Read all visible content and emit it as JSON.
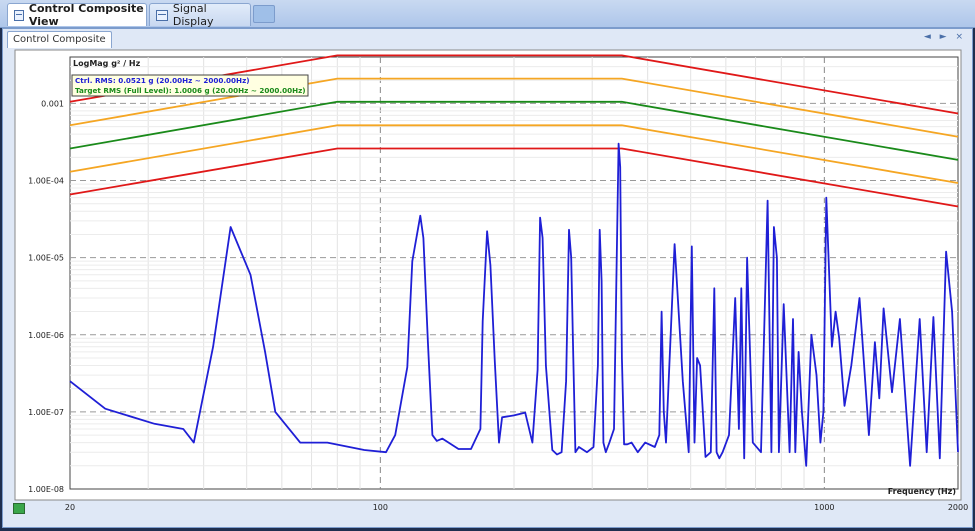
{
  "tabs": [
    {
      "label": "Control Composite View",
      "active": true
    },
    {
      "label": "Signal Display",
      "active": false
    }
  ],
  "panel": {
    "tab_label": "Control Composite",
    "controls": "◄ ► ×"
  },
  "colors": {
    "blue": "#1f1fd6",
    "red": "#e01818",
    "orange": "#f5a623",
    "green": "#1a8a1a",
    "grid": "#b0b0b0"
  },
  "chart_data": {
    "type": "line",
    "ylabel": "LogMag g² / Hz",
    "xlabel": "Frequency (Hz)",
    "x_scale": "log",
    "y_scale": "log",
    "xlim": [
      20,
      2000
    ],
    "ylim": [
      1e-08,
      0.004
    ],
    "x_tick_labels": [
      {
        "value": 20,
        "label": "20"
      },
      {
        "value": 100,
        "label": "100"
      },
      {
        "value": 1000,
        "label": "1000"
      },
      {
        "value": 2000,
        "label": "2000"
      }
    ],
    "y_tick_labels": [
      {
        "value": 0.001,
        "label": "0.001"
      },
      {
        "value": 0.0001,
        "label": "1.00E-04"
      },
      {
        "value": 1e-05,
        "label": "1.00E-05"
      },
      {
        "value": 1e-06,
        "label": "1.00E-06"
      },
      {
        "value": 1e-07,
        "label": "1.00E-07"
      },
      {
        "value": 1e-08,
        "label": "1.00E-08"
      }
    ],
    "grid": true,
    "legend": {
      "placement": "top-left",
      "entries": [
        {
          "text": "Ctrl. RMS: 0.0521 g (20.00Hz ~ 2000.00Hz)",
          "color": "#1f1fd6"
        },
        {
          "text": "Target RMS (Full Level): 1.0006 g (20.00Hz ~ 2000.00Hz)",
          "color": "#1a8a1a"
        }
      ]
    },
    "profile_lines": [
      {
        "color": "#e01818",
        "x": [
          20,
          80,
          350,
          2000
        ],
        "y": [
          0.00105,
          0.0042,
          0.0042,
          0.00074
        ]
      },
      {
        "color": "#f5a623",
        "x": [
          20,
          80,
          350,
          2000
        ],
        "y": [
          0.00052,
          0.0021,
          0.0021,
          0.00037
        ]
      },
      {
        "color": "#1a8a1a",
        "x": [
          20,
          80,
          350,
          2000
        ],
        "y": [
          0.00026,
          0.00105,
          0.00105,
          0.000185
        ]
      },
      {
        "color": "#f5a623",
        "x": [
          20,
          80,
          350,
          2000
        ],
        "y": [
          0.00013,
          0.00052,
          0.00052,
          9.3e-05
        ]
      },
      {
        "color": "#e01818",
        "x": [
          20,
          80,
          350,
          2000
        ],
        "y": [
          6.6e-05,
          0.00026,
          0.00026,
          4.6e-05
        ]
      }
    ],
    "series": [
      {
        "color": "#1f1fd6",
        "x": [
          20,
          24,
          31,
          36,
          38,
          42,
          46,
          51,
          55,
          58,
          66,
          76,
          92,
          103,
          108,
          115,
          118,
          123,
          125,
          128,
          131,
          134,
          138,
          150,
          160,
          168,
          170,
          174,
          177,
          181,
          185,
          188,
          200,
          212,
          220,
          226,
          229,
          232,
          236,
          244,
          250,
          256,
          262,
          266,
          269,
          272,
          275,
          280,
          292,
          302,
          309,
          312,
          315,
          318,
          322,
          328,
          336,
          340,
          344,
          347,
          350,
          354,
          360,
          368,
          380,
          395,
          415,
          425,
          430,
          435,
          440,
          460,
          480,
          495,
          503,
          510,
          517,
          525,
          540,
          555,
          565,
          572,
          580,
          590,
          610,
          630,
          642,
          650,
          660,
          670,
          690,
          720,
          745,
          760,
          770,
          782,
          790,
          810,
          835,
          850,
          860,
          875,
          890,
          910,
          935,
          960,
          980,
          995,
          1010,
          1040,
          1060,
          1080,
          1110,
          1150,
          1200,
          1260,
          1300,
          1330,
          1360,
          1420,
          1480,
          1560,
          1640,
          1700,
          1760,
          1820,
          1880,
          1940,
          2000
        ],
        "y": [
          2.5e-07,
          1.1e-07,
          7e-08,
          6e-08,
          4e-08,
          7e-07,
          2.5e-05,
          6e-06,
          6e-07,
          1e-07,
          4e-08,
          4e-08,
          3.2e-08,
          3e-08,
          5e-08,
          3.8e-07,
          9e-06,
          3.5e-05,
          1.8e-05,
          8e-07,
          5e-08,
          4.2e-08,
          4.5e-08,
          3.3e-08,
          3.3e-08,
          6e-08,
          1.5e-06,
          2.2e-05,
          8e-06,
          4.5e-07,
          4e-08,
          8.5e-08,
          9e-08,
          9.8e-08,
          4e-08,
          3.5e-07,
          3.3e-05,
          1.8e-05,
          4e-07,
          3.2e-08,
          2.8e-08,
          3e-08,
          2.5e-07,
          2.3e-05,
          1e-05,
          5e-07,
          3e-08,
          3.5e-08,
          3e-08,
          3.5e-08,
          4e-07,
          2.3e-05,
          5e-06,
          4e-08,
          3e-08,
          4e-08,
          6e-08,
          4.5e-06,
          0.0003,
          0.00015,
          5e-07,
          3.8e-08,
          3.8e-08,
          4e-08,
          3e-08,
          4e-08,
          3.5e-08,
          5e-08,
          2e-06,
          1e-07,
          4e-08,
          1.5e-05,
          2.5e-07,
          3e-08,
          1.4e-05,
          4e-08,
          5e-07,
          4e-07,
          2.6e-08,
          3e-08,
          4e-06,
          3e-08,
          2.5e-08,
          3e-08,
          5e-08,
          3e-06,
          6e-08,
          4e-06,
          2.5e-08,
          1e-05,
          4e-08,
          3e-08,
          5.5e-05,
          3e-08,
          2.5e-05,
          1e-05,
          3e-08,
          2.5e-06,
          3e-08,
          1.6e-06,
          3e-08,
          6e-07,
          1e-07,
          2e-08,
          1e-06,
          3e-07,
          4e-08,
          1e-07,
          6e-05,
          7e-07,
          2e-06,
          9e-07,
          1.2e-07,
          4e-07,
          3e-06,
          5e-08,
          8e-07,
          1.5e-07,
          2.2e-06,
          1.8e-07,
          1.6e-06,
          2e-08,
          1.6e-06,
          3e-08,
          1.7e-06,
          2.5e-08,
          1.2e-05,
          2e-06,
          3e-08
        ]
      }
    ]
  }
}
